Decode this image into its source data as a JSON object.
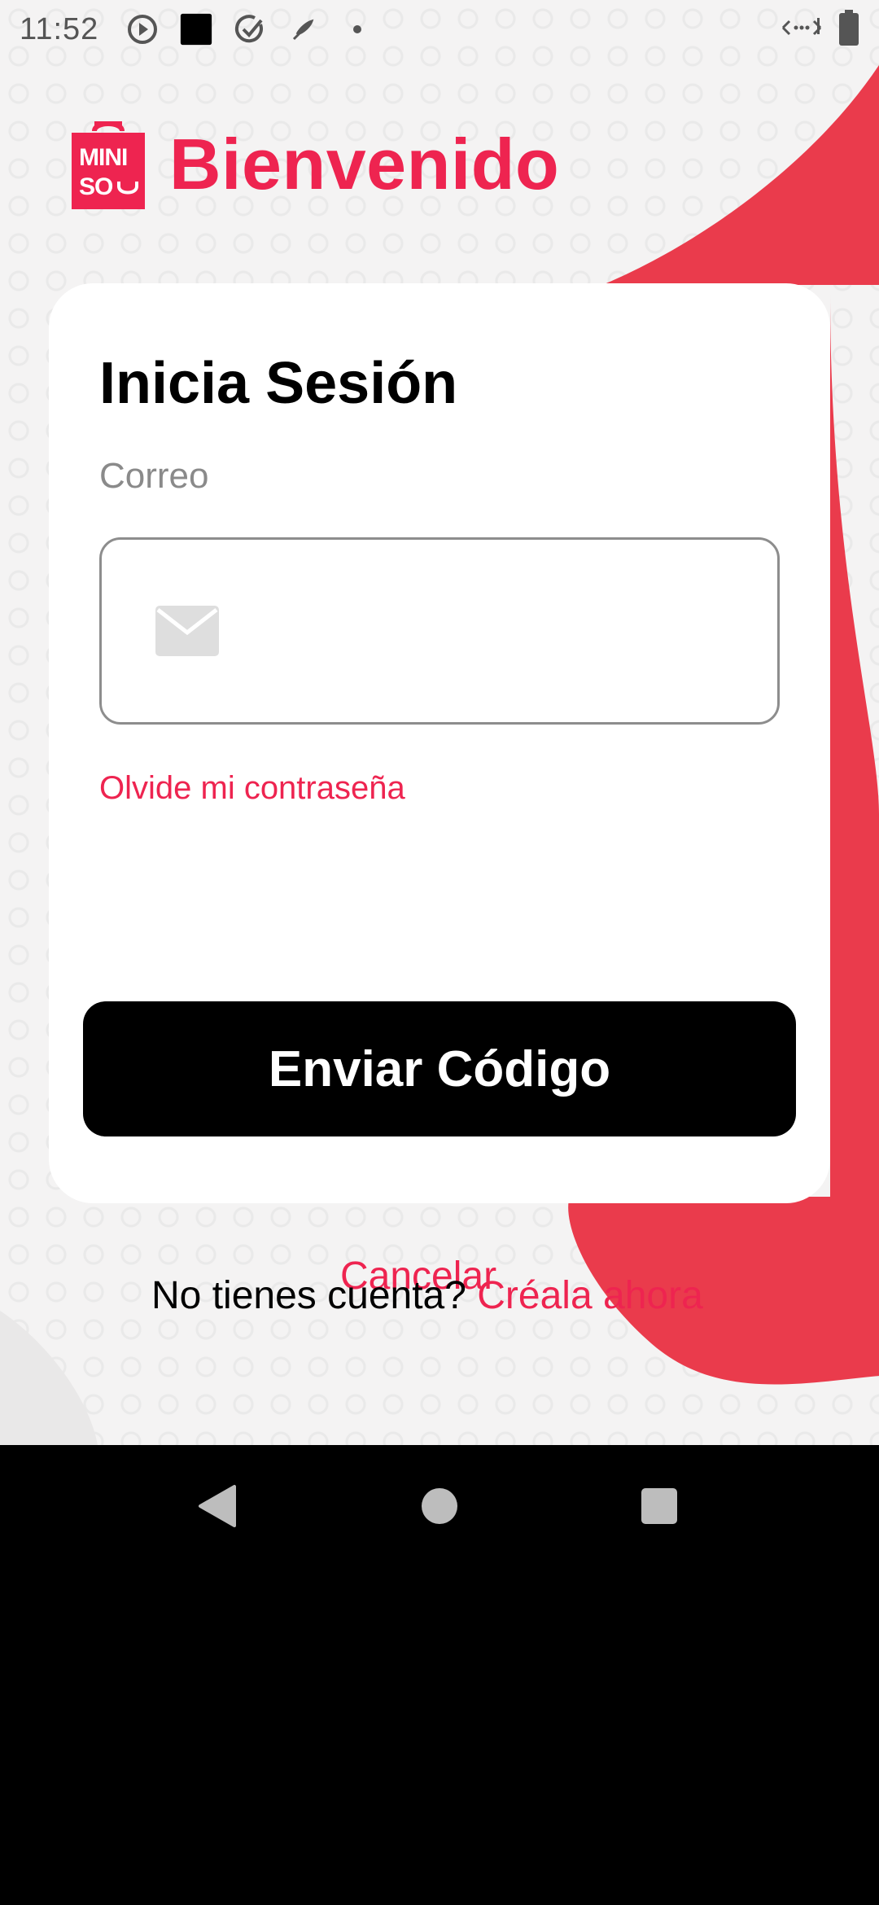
{
  "status_bar": {
    "time": "11:52",
    "icons": [
      "play-circle-icon",
      "square-app-icon",
      "check-circle-icon",
      "feather-icon",
      "dot-icon",
      "data-arrows-icon",
      "battery-icon"
    ]
  },
  "header": {
    "logo_text_top": "MINI",
    "logo_text_bottom": "SO",
    "title": "Bienvenido"
  },
  "card": {
    "title": "Inicia Sesión",
    "email_label": "Correo",
    "email_value": "",
    "forgot_link": "Olvide mi contraseña",
    "send_button": "Enviar Código"
  },
  "footer": {
    "cancel": "Cancelar",
    "no_account": "No tienes cuenta? ",
    "create_link": "Créala ahora"
  },
  "colors": {
    "brand": "#ee2450",
    "blob": "#ea3b4c",
    "button": "#000000"
  },
  "nav": {
    "back": "back-triangle-icon",
    "home": "home-circle-icon",
    "recents": "recents-square-icon"
  }
}
